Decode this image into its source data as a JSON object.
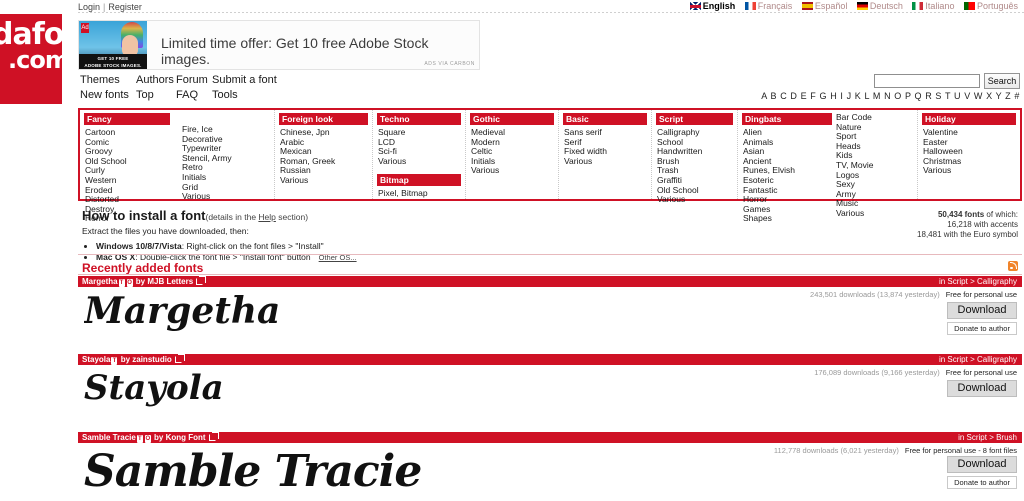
{
  "topbar": {
    "login": "Login",
    "separator": "|",
    "register": "Register",
    "languages": [
      {
        "label": "English",
        "flag": "flag-gb-icon",
        "active": true
      },
      {
        "label": "Français",
        "flag": "flag-fr-icon",
        "active": false
      },
      {
        "label": "Español",
        "flag": "flag-es-icon",
        "active": false
      },
      {
        "label": "Deutsch",
        "flag": "flag-de-icon",
        "active": false
      },
      {
        "label": "Italiano",
        "flag": "flag-it-icon",
        "active": false
      },
      {
        "label": "Português",
        "flag": "flag-pt-icon",
        "active": false
      }
    ]
  },
  "logo": {
    "line1": "dafont",
    "line2": ".com",
    "color": "#cf1125"
  },
  "ad": {
    "text": "Limited time offer: Get 10 free Adobe Stock images.",
    "badge": "Ad",
    "image_caption_line1": "GET 10 FREE",
    "image_caption_line2": "ADOBE STOCK IMAGES.",
    "attribution": "ADS VIA CARBON"
  },
  "nav": {
    "row1": [
      "Themes",
      "Authors",
      "Forum",
      "Submit a font"
    ],
    "row2": [
      "New fonts",
      "Top",
      "FAQ",
      "Tools"
    ]
  },
  "search": {
    "value": "",
    "placeholder": "",
    "button": "Search"
  },
  "alphabet": "A B C D E F G H I J K L M N O P Q R S T U V W X Y Z #",
  "categories": [
    {
      "heading": "Fancy",
      "items": [
        "Cartoon",
        "Comic",
        "Groovy",
        "Old School",
        "Curly",
        "Western",
        "Eroded",
        "Distorted",
        "Destroy",
        "Horror"
      ],
      "items2": [
        "Fire, Ice",
        "Decorative",
        "Typewriter",
        "Stencil, Army",
        "Retro",
        "Initials",
        "Grid",
        "Various"
      ]
    },
    {
      "heading": "Foreign look",
      "items": [
        "Chinese, Jpn",
        "Arabic",
        "Mexican",
        "Roman, Greek",
        "Russian",
        "Various"
      ]
    },
    {
      "heading": "Techno",
      "items": [
        "Square",
        "LCD",
        "Sci-fi",
        "Various"
      ],
      "heading2": "Bitmap",
      "items2": [
        "Pixel, Bitmap"
      ]
    },
    {
      "heading": "Gothic",
      "items": [
        "Medieval",
        "Modern",
        "Celtic",
        "Initials",
        "Various"
      ]
    },
    {
      "heading": "Basic",
      "items": [
        "Sans serif",
        "Serif",
        "Fixed width",
        "Various"
      ]
    },
    {
      "heading": "Script",
      "items": [
        "Calligraphy",
        "School",
        "Handwritten",
        "Brush",
        "Trash",
        "Graffiti",
        "Old School",
        "Various"
      ]
    },
    {
      "heading": "Dingbats",
      "items": [
        "Alien",
        "Animals",
        "Asian",
        "Ancient",
        "Runes, Elvish",
        "Esoteric",
        "Fantastic",
        "Horror",
        "Games",
        "Shapes"
      ],
      "items2": [
        "Bar Code",
        "Nature",
        "Sport",
        "Heads",
        "Kids",
        "TV, Movie",
        "Logos",
        "Sexy",
        "Army",
        "Music",
        "Various"
      ]
    },
    {
      "heading": "Holiday",
      "items": [
        "Valentine",
        "Easter",
        "Halloween",
        "Christmas",
        "Various"
      ]
    }
  ],
  "howto": {
    "title": "How to install a font",
    "subtitle_pre": "(details in the ",
    "subtitle_link": "Help",
    "subtitle_post": " section)",
    "extract": "Extract the files you have downloaded, then:",
    "bullets": [
      {
        "bold": "Windows 10/8/7/Vista",
        "rest": ": Right-click on the font files > \"Install\"",
        "link": ""
      },
      {
        "bold": "Mac OS X",
        "rest": ": Double-click the font file > \"Install font\" button",
        "link": "Other OS..."
      }
    ]
  },
  "counts": {
    "total": "50,434 fonts",
    "of_which": " of which:",
    "accents": "16,218 with accents",
    "euro": "18,481 with the Euro symbol"
  },
  "recently": {
    "title": "Recently added fonts",
    "rss": "rss-icon"
  },
  "fonts": [
    {
      "name": "Margetha",
      "by": "by MJB Letters",
      "badges": [
        "T",
        "O"
      ],
      "category": "in Script > Calligraphy",
      "downloads": "243,501 downloads (13,874 yesterday)",
      "license": "Free for personal use",
      "download_label": "Download",
      "donate_label": "Donate to author",
      "preview": "Margetha"
    },
    {
      "name": "Stayola",
      "by": "by zainstudio",
      "badges": [
        "T"
      ],
      "category": "in Script > Calligraphy",
      "downloads": "176,089 downloads (9,166 yesterday)",
      "license": "Free for personal use",
      "download_label": "Download",
      "donate_label": "",
      "preview": "Stayola"
    },
    {
      "name": "Samble Tracie",
      "by": "by Kong Font",
      "badges": [
        "T",
        "O"
      ],
      "category": "in Script > Brush",
      "downloads": "112,778 downloads (6,021 yesterday)",
      "license": "Free for personal use - 8 font files",
      "download_label": "Download",
      "donate_label": "Donate to author",
      "preview": "Samble Tracie"
    }
  ]
}
